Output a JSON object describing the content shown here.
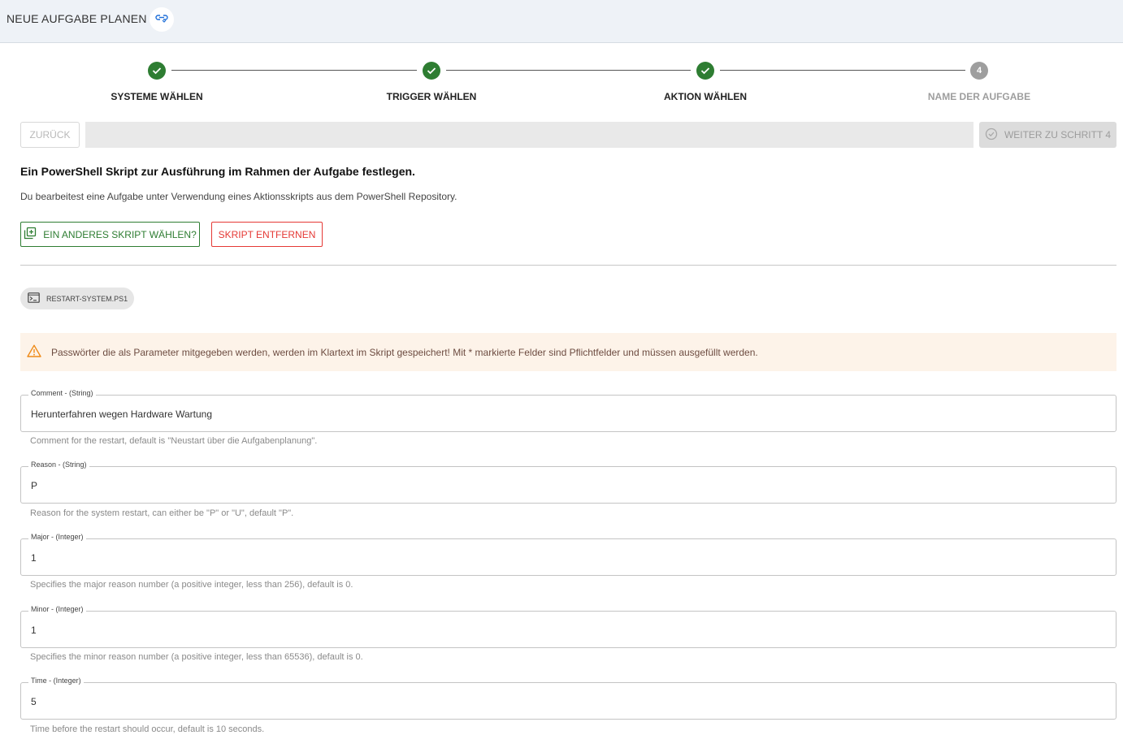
{
  "header": {
    "title": "NEUE AUFGABE PLANEN",
    "link_icon": "link-icon"
  },
  "stepper": {
    "steps": [
      {
        "label": "SYSTEME WÄHLEN",
        "status": "done"
      },
      {
        "label": "TRIGGER WÄHLEN",
        "status": "done"
      },
      {
        "label": "AKTION WÄHLEN",
        "status": "done"
      },
      {
        "label": "NAME DER AUFGABE",
        "status": "todo",
        "number": "4"
      }
    ]
  },
  "nav": {
    "back_label": "ZURÜCK",
    "next_label": "WEITER ZU SCHRITT 4"
  },
  "section": {
    "title": "Ein PowerShell Skript zur Ausführung im Rahmen der Aufgabe festlegen.",
    "description": "Du bearbeitest eine Aufgabe unter Verwendung eines Aktionsskripts aus dem PowerShell Repository."
  },
  "actions": {
    "choose_label": "EIN ANDERES SKRIPT WÄHLEN?",
    "remove_label": "SKRIPT ENTFERNEN"
  },
  "script_chip": {
    "label": "RESTART-SYSTEM.PS1",
    "icon": "terminal-icon"
  },
  "warning": {
    "text": "Passwörter die als Parameter mitgegeben werden, werden im Klartext im Skript gespeichert! Mit * markierte Felder sind Pflichtfelder und müssen ausgefüllt werden.",
    "icon": "warning-icon"
  },
  "params": [
    {
      "legend": "Comment - (String)",
      "value": "Herunterfahren wegen Hardware Wartung",
      "help": "Comment for the restart, default is \"Neustart über die Aufgabenplanung\"."
    },
    {
      "legend": "Reason - (String)",
      "value": "P",
      "help": "Reason for the system restart, can either be \"P\" or \"U\", default \"P\"."
    },
    {
      "legend": "Major - (Integer)",
      "value": "1",
      "help": "Specifies the major reason number (a positive integer, less than 256), default is 0."
    },
    {
      "legend": "Minor - (Integer)",
      "value": "1",
      "help": "Specifies the minor reason number (a positive integer, less than 65536), default is 0."
    },
    {
      "legend": "Time - (Integer)",
      "value": "5",
      "help": "Time before the restart should occur, default is 10 seconds."
    }
  ],
  "colors": {
    "accent_green": "#2e7d32",
    "danger_red": "#e53935",
    "warning_bg": "#fdf3e9",
    "header_bg": "#eef2f7"
  }
}
